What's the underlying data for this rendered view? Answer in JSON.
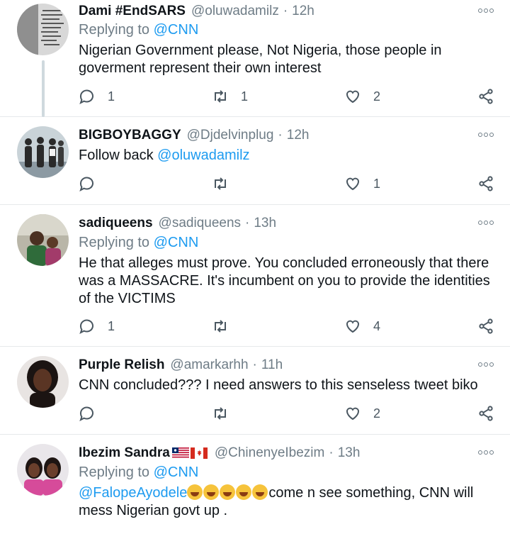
{
  "tweets": [
    {
      "name": "Dami #EndSARS",
      "handle": "@oluwadamilz",
      "sep": "·",
      "time": "12h",
      "replying_label": "Replying to",
      "replying_to": "@CNN",
      "text": "Nigerian Government please, Not Nigeria, those people in goverment represent their own interest",
      "avatar_icon": "avatar-text-image",
      "replies": "1",
      "retweets": "1",
      "likes": "2"
    },
    {
      "name": "BIGBOYBAGGY",
      "handle": "@Djdelvinplug",
      "sep": "·",
      "time": "12h",
      "text_prefix": "Follow back",
      "text_mention": "@oluwadamilz",
      "avatar_icon": "avatar-group-photo",
      "replies": "",
      "retweets": "",
      "likes": "1"
    },
    {
      "name": "sadiqueens",
      "handle": "@sadiqueens",
      "sep": "·",
      "time": "13h",
      "replying_label": "Replying to",
      "replying_to": "@CNN",
      "text": "He that alleges must prove. You concluded erroneously that there was a MASSACRE. It's incumbent on you to provide the identities of the VICTIMS",
      "avatar_icon": "avatar-photo",
      "replies": "1",
      "retweets": "",
      "likes": "4"
    },
    {
      "name": "Purple Relish",
      "handle": "@amarkarhh",
      "sep": "·",
      "time": "11h",
      "text": "CNN concluded??? I need answers to this senseless tweet biko",
      "avatar_icon": "avatar-portrait",
      "replies": "",
      "retweets": "",
      "likes": "2"
    },
    {
      "name": "Ibezim Sandra",
      "handle": "@ChinenyeIbezim",
      "sep": "·",
      "time": "13h",
      "replying_label": "Replying to",
      "replying_to": "@CNN",
      "text_mention": "@FalopeAyodele",
      "text_suffix_line1": "come n see something, CNN will",
      "text_suffix_line2": "mess Nigerian govt up .",
      "flags": [
        "liberia-flag",
        "canada-flag"
      ],
      "emojis": [
        "rolling-laughing-emoji",
        "grinning-sweat-emoji",
        "rolling-laughing-emoji",
        "grinning-sweat-emoji",
        "rolling-laughing-emoji"
      ],
      "avatar_icon": "avatar-two-women"
    }
  ],
  "colors": {
    "link": "#1d9bf0",
    "secondary_text": "#6e7c86",
    "divider": "#e6e9eb",
    "thread_line": "#cfd9de"
  },
  "icons": {
    "reply": "reply-icon",
    "retweet": "retweet-icon",
    "like": "heart-icon",
    "share": "share-icon",
    "more": "more-options-icon"
  }
}
